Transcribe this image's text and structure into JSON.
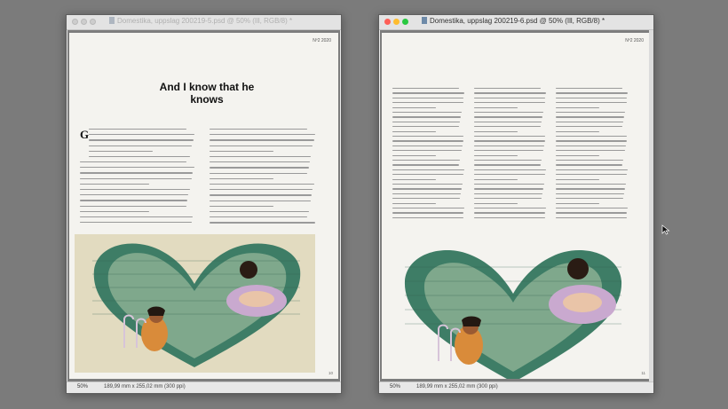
{
  "windows": [
    {
      "title": "Domestika, uppslag 200219-5.psd @ 50% (Ill, RGB/8) *",
      "issue": "Nº2 2020",
      "headline": "And I know that he knows",
      "dropcap": "G",
      "page_number": "10",
      "zoom": "50%",
      "doc_info": "189,99 mm x 255,02 mm (300 ppi)"
    },
    {
      "title": "Domestika, uppslag 200219-6.psd @ 50% (Ill, RGB/8) *",
      "issue": "Nº2 2020",
      "page_number": "11",
      "zoom": "50%",
      "doc_info": "189,99 mm x 255,02 mm (300 ppi)"
    }
  ],
  "colors": {
    "close": "#fe5f57",
    "minimize": "#febc2e",
    "zoom": "#28c840",
    "pool_tile": "#3e7d66",
    "pool_water": "#7fa88c",
    "float_ring": "#c9a9cf"
  }
}
